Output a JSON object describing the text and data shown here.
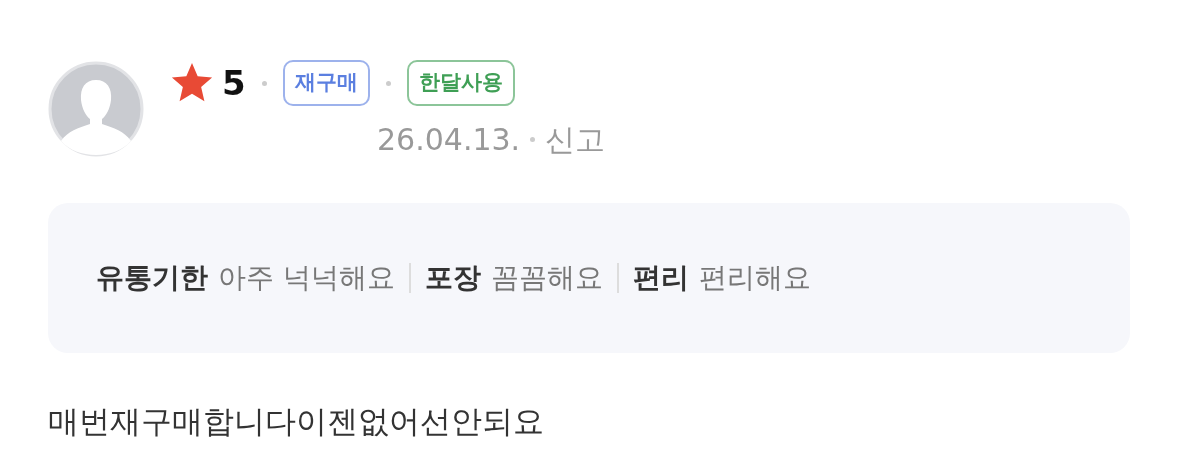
{
  "review": {
    "rating": "5",
    "badges": [
      {
        "label": "재구매",
        "color": "#5b7fe0"
      },
      {
        "label": "한달사용",
        "color": "#3f9f55"
      }
    ],
    "date": "26.04.13.",
    "report": "신고",
    "attributes": [
      {
        "name": "유통기한",
        "value": "아주 넉넉해요"
      },
      {
        "name": "포장",
        "value": "꼼꼼해요"
      },
      {
        "name": "편리",
        "value": "편리해요"
      }
    ],
    "text": "매번재구매합니다이젠없어선안되요"
  }
}
